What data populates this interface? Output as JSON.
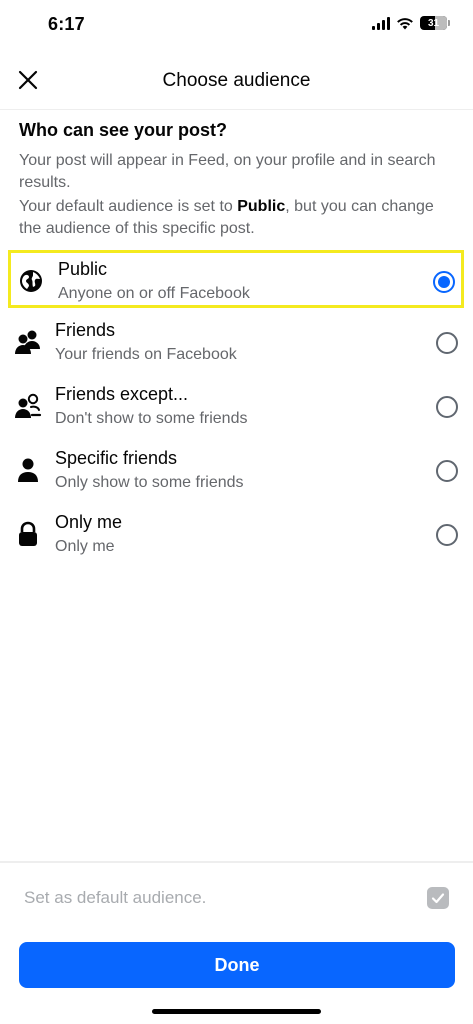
{
  "status_bar": {
    "time": "6:17",
    "battery": "31"
  },
  "header": {
    "title": "Choose audience"
  },
  "intro": {
    "heading": "Who can see your post?",
    "line1": "Your post will appear in Feed, on your profile and in search results.",
    "line2_prefix": "Your default audience is set to ",
    "line2_bold": "Public",
    "line2_suffix": ", but you can change the audience of this specific post."
  },
  "options": [
    {
      "title": "Public",
      "subtitle": "Anyone on or off Facebook",
      "icon": "globe-icon",
      "selected": true
    },
    {
      "title": "Friends",
      "subtitle": "Your friends on Facebook",
      "icon": "friends-icon",
      "selected": false
    },
    {
      "title": "Friends except...",
      "subtitle": "Don't show to some friends",
      "icon": "friends-except-icon",
      "selected": false
    },
    {
      "title": "Specific friends",
      "subtitle": "Only show to some friends",
      "icon": "person-icon",
      "selected": false
    },
    {
      "title": "Only me",
      "subtitle": "Only me",
      "icon": "lock-icon",
      "selected": false
    }
  ],
  "footer": {
    "default_label": "Set as default audience.",
    "default_checked": true,
    "done_label": "Done"
  },
  "colors": {
    "accent": "#0866ff",
    "highlight": "#f4ea1f",
    "secondary_text": "#65676b"
  }
}
